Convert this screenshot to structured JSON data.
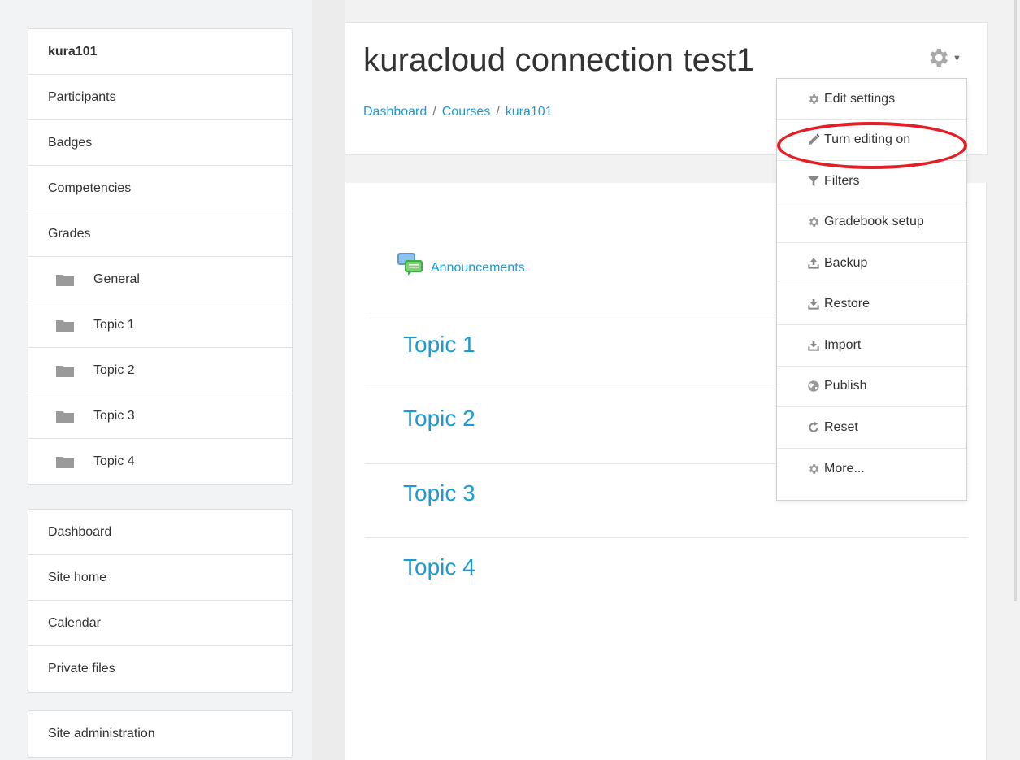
{
  "sidebar": {
    "course_nav": [
      {
        "label": "kura101",
        "bold": true
      },
      {
        "label": "Participants"
      },
      {
        "label": "Badges"
      },
      {
        "label": "Competencies"
      },
      {
        "label": "Grades"
      },
      {
        "label": "General",
        "folder": true
      },
      {
        "label": "Topic 1",
        "folder": true
      },
      {
        "label": "Topic 2",
        "folder": true
      },
      {
        "label": "Topic 3",
        "folder": true
      },
      {
        "label": "Topic 4",
        "folder": true
      }
    ],
    "site_nav": [
      {
        "label": "Dashboard"
      },
      {
        "label": "Site home"
      },
      {
        "label": "Calendar"
      },
      {
        "label": "Private files"
      }
    ],
    "admin_nav": [
      {
        "label": "Site administration"
      }
    ]
  },
  "header": {
    "title": "kuracloud connection test1",
    "breadcrumb": [
      "Dashboard",
      "Courses",
      "kura101"
    ],
    "breadcrumb_separator": "/"
  },
  "content": {
    "announcements_label": "Announcements",
    "topics": [
      "Topic 1",
      "Topic 2",
      "Topic 3",
      "Topic 4"
    ]
  },
  "actions_menu": {
    "items": [
      {
        "label": "Edit settings",
        "icon": "gear-icon"
      },
      {
        "label": "Turn editing on",
        "icon": "pencil-icon",
        "highlighted": true
      },
      {
        "label": "Filters",
        "icon": "filter-icon"
      },
      {
        "label": "Gradebook setup",
        "icon": "gear-icon"
      },
      {
        "label": "Backup",
        "icon": "upload-icon"
      },
      {
        "label": "Restore",
        "icon": "download-icon"
      },
      {
        "label": "Import",
        "icon": "download-icon"
      },
      {
        "label": "Publish",
        "icon": "globe-icon"
      },
      {
        "label": "Reset",
        "icon": "reset-icon"
      },
      {
        "label": "More...",
        "icon": "gear-icon"
      }
    ]
  },
  "colors": {
    "link": "#1a9bd7",
    "highlight_ring": "#e41e26",
    "text": "#333333"
  }
}
